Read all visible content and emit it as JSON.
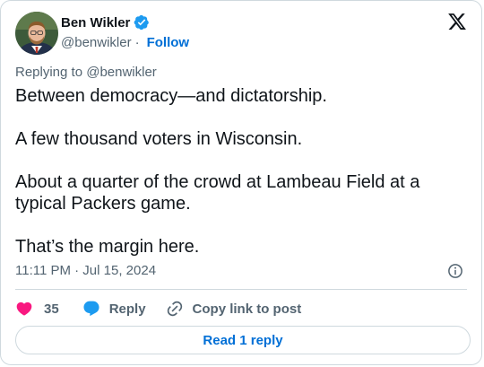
{
  "author": {
    "name": "Ben Wikler",
    "handle": "@benwikler",
    "separator": "·",
    "follow_label": "Follow"
  },
  "replying_to": "Replying to @benwikler",
  "tweet": {
    "text": "Between democracy—and dictatorship.\n\nA few thousand voters in Wisconsin.\n\nAbout a quarter of the crowd at Lambeau Field at a typical Packers game.\n\nThat’s the margin here.",
    "timestamp": "11:11 PM · Jul 15, 2024"
  },
  "actions": {
    "like_count": "35",
    "reply_label": "Reply",
    "copy_label": "Copy link to post"
  },
  "read_replies_label": "Read 1 reply",
  "icons": {
    "verified": "verified-badge-icon",
    "logo": "x-logo-icon",
    "info": "info-icon",
    "like": "heart-icon",
    "reply": "speech-bubble-icon",
    "copy": "link-icon"
  },
  "colors": {
    "link_blue": "#006fd6",
    "verified_blue": "#1d9bf0",
    "heart_pink": "#f91880",
    "text_primary": "#0f1419",
    "text_secondary": "#536471",
    "border": "#cfd9de"
  }
}
